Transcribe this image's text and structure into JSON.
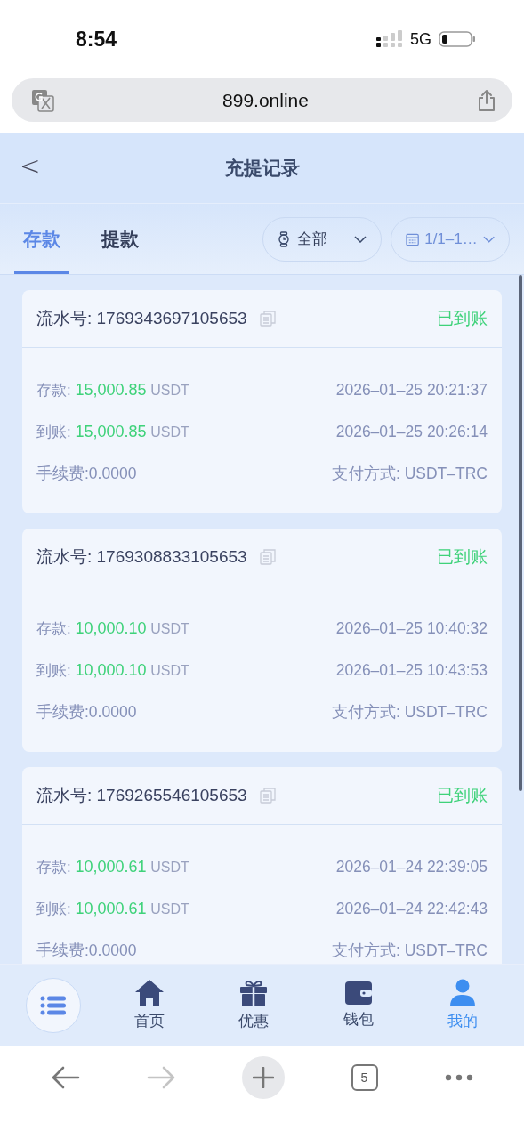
{
  "status_bar": {
    "time": "8:54",
    "network": "5G"
  },
  "browser": {
    "url": "899.online",
    "tab_count": "5",
    "forward_disabled": true
  },
  "header": {
    "title": "充提记录",
    "back": "<"
  },
  "tabs": [
    {
      "label": "存款",
      "selected": true
    },
    {
      "label": "提款",
      "selected": false
    }
  ],
  "filters": [
    {
      "kind": "status",
      "label": "全部"
    },
    {
      "kind": "date",
      "label": "1/1–1…"
    }
  ],
  "records": [
    {
      "serial_label": "流水号:",
      "serial": "1769343697105653",
      "status": "已到账",
      "deposit_label": "存款:",
      "deposit": "15,000.85",
      "deposit_unit": "USDT",
      "deposit_time": "2026–01–25 20:21:37",
      "credit_label": "到账:",
      "credit": "15,000.85",
      "credit_unit": "USDT",
      "credit_time": "2026–01–25 20:26:14",
      "fee": "手续费:0.0000",
      "method": "支付方式: USDT–TRC"
    },
    {
      "serial_label": "流水号:",
      "serial": "1769308833105653",
      "status": "已到账",
      "deposit_label": "存款:",
      "deposit": "10,000.10",
      "deposit_unit": "USDT",
      "deposit_time": "2026–01–25 10:40:32",
      "credit_label": "到账:",
      "credit": "10,000.10",
      "credit_unit": "USDT",
      "credit_time": "2026–01–25 10:43:53",
      "fee": "手续费:0.0000",
      "method": "支付方式: USDT–TRC"
    },
    {
      "serial_label": "流水号:",
      "serial": "1769265546105653",
      "status": "已到账",
      "deposit_label": "存款:",
      "deposit": "10,000.61",
      "deposit_unit": "USDT",
      "deposit_time": "2026–01–24 22:39:05",
      "credit_label": "到账:",
      "credit": "10,000.61",
      "credit_unit": "USDT",
      "credit_time": "2026–01–24 22:42:43",
      "fee": "手续费:0.0000",
      "method": "支付方式: USDT–TRC"
    }
  ],
  "nav": [
    {
      "kind": "home",
      "label": "首页",
      "selected": false
    },
    {
      "kind": "gift",
      "label": "优惠",
      "selected": false
    },
    {
      "kind": "wallet",
      "label": "钱包",
      "selected": false
    },
    {
      "kind": "user",
      "label": "我的",
      "selected": true
    }
  ]
}
